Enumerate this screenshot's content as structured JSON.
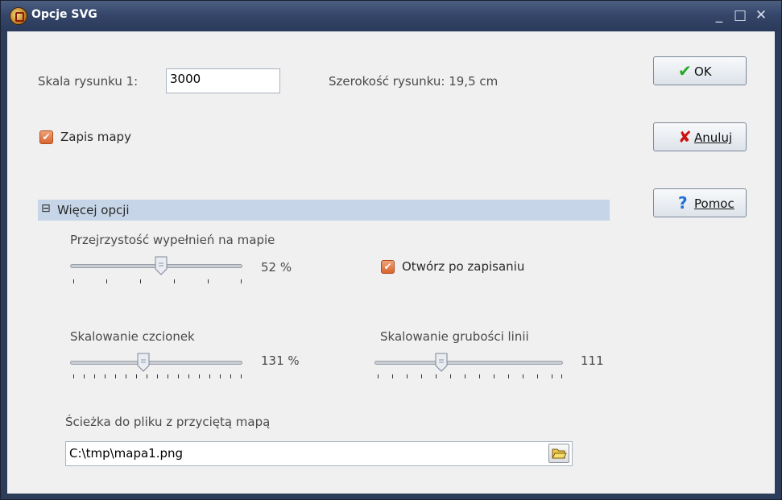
{
  "window": {
    "title": "Opcje SVG",
    "controls": {
      "minimize": "_",
      "maximize": "□",
      "close": "✕"
    }
  },
  "scale": {
    "label": "Skala rysunku 1:",
    "value": "3000",
    "width_text": "Szerokość rysunku: 19,5 cm"
  },
  "save_map": {
    "label": "Zapis mapy",
    "checked": true
  },
  "more_options": {
    "toggle": "⊟",
    "label": "Więcej opcji"
  },
  "transparency": {
    "label": "Przejrzystość wypełnień na mapie",
    "value_text": "52 %",
    "value": 52
  },
  "open_after": {
    "label": "Otwórz po zapisaniu",
    "checked": true
  },
  "font_scale": {
    "label": "Skalowanie czcionek",
    "value_text": "131 %",
    "value": 131
  },
  "line_scale": {
    "label": "Skalowanie grubości linii",
    "value_text": "111",
    "value": 111
  },
  "path": {
    "label": "Ścieżka do pliku z przyciętą mapą",
    "value": "C:\\tmp\\mapa1.png"
  },
  "buttons": {
    "ok": "OK",
    "cancel": "Anuluj",
    "help": "Pomoc"
  },
  "icons": {
    "ok": "check-icon",
    "cancel": "x-icon",
    "help": "question-icon",
    "browse": "folder-open-icon"
  },
  "colors": {
    "ok": "#22aa22",
    "cancel": "#cc1111",
    "help": "#1e6fd9",
    "checkbox": "#e07a45"
  }
}
